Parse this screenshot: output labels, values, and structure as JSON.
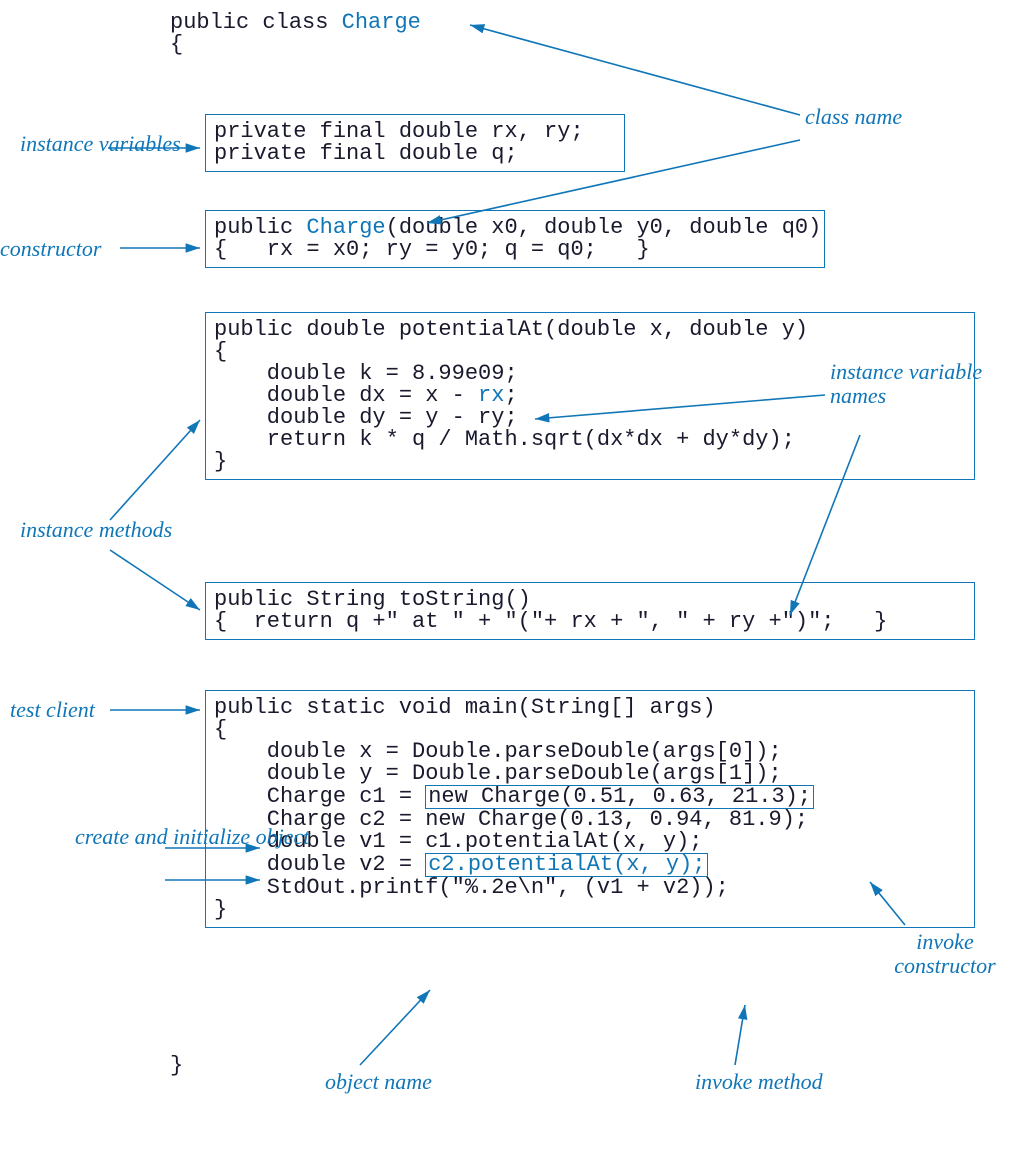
{
  "labels": {
    "class_name": "class\nname",
    "instance_variables": "instance\nvariables",
    "constructor": "constructor",
    "instance_methods": "instance\nmethods",
    "instance_variable_names": "instance\nvariable\nnames",
    "test_client": "test client",
    "create_initialize": "create\nand\ninitialize\nobject",
    "invoke_constructor": "invoke\nconstructor",
    "invoke_method": "invoke\nmethod",
    "object_name": "object\nname"
  },
  "code": {
    "class_decl_prefix": "public class ",
    "class_name": "Charge",
    "open_brace": "{",
    "close_brace": "}",
    "ivars_line1": "private final double rx, ry;",
    "ivars_line2": "private final double q;",
    "ctor_prefix": "public ",
    "ctor_name": "Charge",
    "ctor_params": "(double x0, double y0, double q0)",
    "ctor_body": "{   rx = x0; ry = y0; q = q0;   }",
    "pa_sig": "public double potentialAt(double x, double y)",
    "pa_open": "{",
    "pa_l1": "    double k = 8.99e09;",
    "pa_l2a": "    double dx = x - ",
    "pa_l2_rx": "rx",
    "pa_l2b": ";",
    "pa_l3": "    double dy = y - ry;",
    "pa_l4": "    return k * q / Math.sqrt(dx*dx + dy*dy);",
    "pa_close": "}",
    "ts_sig": "public String toString()",
    "ts_body": "{  return q +\" at \" + \"(\"+ rx + \", \" + ry +\")\";   }",
    "main_sig": "public static void main(String[] args)",
    "main_open": "{",
    "main_l1": "    double x = Double.parseDouble(args[0]);",
    "main_l2": "    double y = Double.parseDouble(args[1]);",
    "main_l3a": "    Charge c1 = ",
    "main_l3_box": "new Charge(0.51, 0.63, 21.3);",
    "main_l4": "    Charge c2 = new Charge(0.13, 0.94, 81.9);",
    "main_l5": "    double v1 = c1.potentialAt(x, y);",
    "main_l6a": "    double v2 = ",
    "main_l6_box": "c2.potentialAt(x, y);",
    "main_l7": "    StdOut.printf(\"%.2e\\n\", (v1 + v2));",
    "main_close": "}"
  }
}
